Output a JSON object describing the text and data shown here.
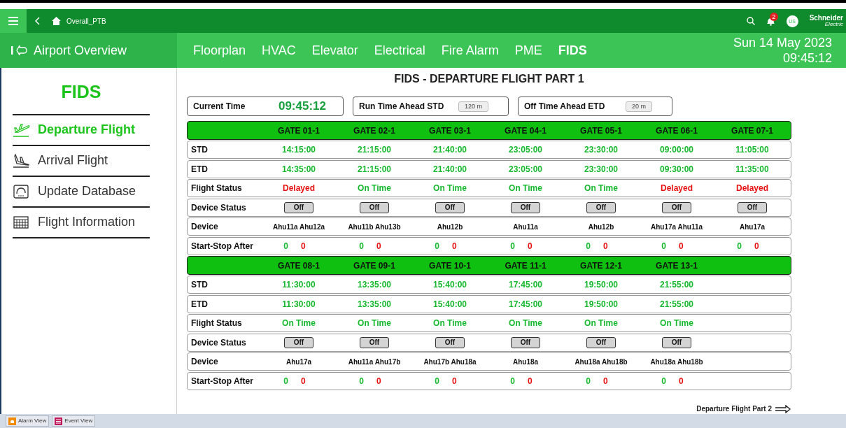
{
  "topbar": {
    "breadcrumb": "Overall_PTB",
    "notification_count": "2",
    "user": "US",
    "brand": "Schneider",
    "brand_sub": "Electric"
  },
  "header": {
    "title": "Airport Overview",
    "date": "Sun 14 May 2023",
    "time": "09:45:12"
  },
  "tabs": [
    {
      "label": "Floorplan",
      "selected": false
    },
    {
      "label": "HVAC",
      "selected": false
    },
    {
      "label": "Elevator",
      "selected": false
    },
    {
      "label": "Electrical",
      "selected": false
    },
    {
      "label": "Fire Alarm",
      "selected": false
    },
    {
      "label": "PME",
      "selected": false
    },
    {
      "label": "FIDS",
      "selected": true
    }
  ],
  "sidebar": {
    "title": "FIDS",
    "items": [
      {
        "label": "Departure Flight",
        "kind": "departure",
        "selected": true
      },
      {
        "label": "Arrival Flight",
        "kind": "arrival",
        "selected": false
      },
      {
        "label": "Update Database",
        "kind": "database",
        "selected": false
      },
      {
        "label": "Flight Information",
        "kind": "grid",
        "selected": false
      }
    ]
  },
  "page_title": "FIDS - DEPARTURE FLIGHT PART 1",
  "info": {
    "current_time_label": "Current Time",
    "current_time": "09:45:12",
    "std_label": "Run Time Ahead STD",
    "std_value": "120 m",
    "etd_label": "Off Time Ahead ETD",
    "etd_value": "20 m"
  },
  "blocks": [
    {
      "row_labels": [
        "STD",
        "ETD",
        "Flight Status",
        "Device Status",
        "Device",
        "Start-Stop After"
      ],
      "gates": [
        {
          "name": "GATE 01-1",
          "std": "14:15:00",
          "etd": "14:35:00",
          "status": {
            "text": "Delayed",
            "kind": "delayed"
          },
          "device_status": "Off",
          "device": "Ahu11a Ahu12a",
          "start": "0",
          "stop": "0"
        },
        {
          "name": "GATE 02-1",
          "std": "21:15:00",
          "etd": "21:15:00",
          "status": {
            "text": "On Time",
            "kind": "on_time"
          },
          "device_status": "Off",
          "device": "Ahu11b Ahu13b",
          "start": "0",
          "stop": "0"
        },
        {
          "name": "GATE 03-1",
          "std": "21:40:00",
          "etd": "21:40:00",
          "status": {
            "text": "On Time",
            "kind": "on_time"
          },
          "device_status": "Off",
          "device": "Ahu12b",
          "start": "0",
          "stop": "0"
        },
        {
          "name": "GATE 04-1",
          "std": "23:05:00",
          "etd": "23:05:00",
          "status": {
            "text": "On Time",
            "kind": "on_time"
          },
          "device_status": "Off",
          "device": "Ahu11a",
          "start": "0",
          "stop": "0"
        },
        {
          "name": "GATE 05-1",
          "std": "23:30:00",
          "etd": "23:30:00",
          "status": {
            "text": "On Time",
            "kind": "on_time"
          },
          "device_status": "Off",
          "device": "Ahu12b",
          "start": "0",
          "stop": "0"
        },
        {
          "name": "GATE 06-1",
          "std": "09:00:00",
          "etd": "09:30:00",
          "status": {
            "text": "Delayed",
            "kind": "delayed"
          },
          "device_status": "Off",
          "device": "Ahu17a Ahu11a",
          "start": "0",
          "stop": "0"
        },
        {
          "name": "GATE 07-1",
          "std": "11:05:00",
          "etd": "11:35:00",
          "status": {
            "text": "Delayed",
            "kind": "delayed"
          },
          "device_status": "Off",
          "device": "Ahu17a",
          "start": "0",
          "stop": "0"
        }
      ]
    },
    {
      "row_labels": [
        "STD",
        "ETD",
        "Flight Status",
        "Device Status",
        "Device",
        "Start-Stop After"
      ],
      "gates": [
        {
          "name": "GATE 08-1",
          "std": "11:30:00",
          "etd": "11:30:00",
          "status": {
            "text": "On Time",
            "kind": "on_time"
          },
          "device_status": "Off",
          "device": "Ahu17a",
          "start": "0",
          "stop": "0"
        },
        {
          "name": "GATE 09-1",
          "std": "13:35:00",
          "etd": "13:35:00",
          "status": {
            "text": "On Time",
            "kind": "on_time"
          },
          "device_status": "Off",
          "device": "Ahu11a Ahu17b",
          "start": "0",
          "stop": "0"
        },
        {
          "name": "GATE 10-1",
          "std": "15:40:00",
          "etd": "15:40:00",
          "status": {
            "text": "On Time",
            "kind": "on_time"
          },
          "device_status": "Off",
          "device": "Ahu17b Ahu18a",
          "start": "0",
          "stop": "0"
        },
        {
          "name": "GATE 11-1",
          "std": "17:45:00",
          "etd": "17:45:00",
          "status": {
            "text": "On Time",
            "kind": "on_time"
          },
          "device_status": "Off",
          "device": "Ahu18a",
          "start": "0",
          "stop": "0"
        },
        {
          "name": "GATE 12-1",
          "std": "19:50:00",
          "etd": "19:50:00",
          "status": {
            "text": "On Time",
            "kind": "on_time"
          },
          "device_status": "Off",
          "device": "Ahu18a Ahu18b",
          "start": "0",
          "stop": "0"
        },
        {
          "name": "GATE 13-1",
          "std": "21:55:00",
          "etd": "21:55:00",
          "status": {
            "text": "On Time",
            "kind": "on_time"
          },
          "device_status": "Off",
          "device": "Ahu18a Ahu18b",
          "start": "0",
          "stop": "0"
        }
      ]
    }
  ],
  "next_link": "Departure Flight Part 2",
  "bottom_tabs": [
    {
      "label": "Alarm View",
      "kind": "alarm"
    },
    {
      "label": "Event View",
      "kind": "event"
    }
  ]
}
